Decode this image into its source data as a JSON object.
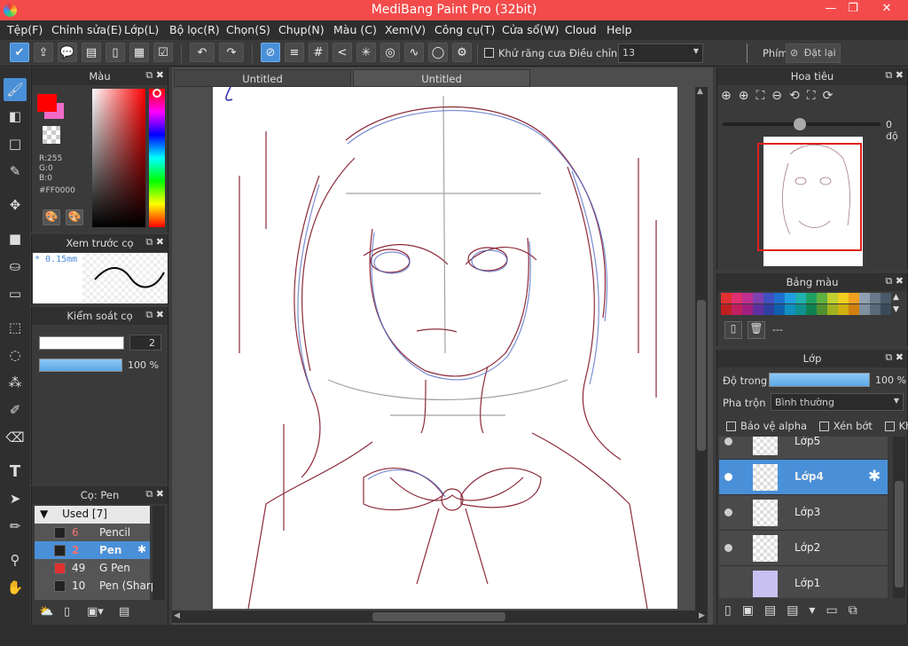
{
  "window": {
    "title": "MediBang Paint Pro (32bit)",
    "min": "—",
    "max": "❐",
    "close": "✕"
  },
  "menu": [
    "Tệp(F)",
    "Chỉnh sửa(E)",
    "Lớp(L)",
    "Bộ lọc(R)",
    "Chọn(S)",
    "Chụp(N)",
    "Màu (C)",
    "Xem(V)",
    "Công cụ(T)",
    "Cửa sổ(W)",
    "Cloud",
    "Help"
  ],
  "toolbar": {
    "antialias_label": "Khử răng cưa",
    "correction_label": "Điều chỉnh",
    "correction_value": "13",
    "key_label": "Phím",
    "reset_label": "Đặt lại"
  },
  "color_panel": {
    "title": "Màu",
    "r": "R:255",
    "g": "G:0",
    "b": "B:0",
    "hex": "#FF0000",
    "fg_color": "#FF0000",
    "bg_color": "#F06CC8"
  },
  "brush_preview": {
    "title": "Xem trước cọ",
    "size": "* 0.15mm"
  },
  "brush_control": {
    "title": "Kiểm soát cọ",
    "size": "2",
    "opacity": "100 %",
    "opacity_value": 1.0
  },
  "brush_panel": {
    "title": "Cọ: Pen",
    "group": "Used [7]",
    "items": [
      {
        "num": "6",
        "name": "Pencil",
        "color": "#222222"
      },
      {
        "num": "2",
        "name": "Pen",
        "color": "#222222"
      },
      {
        "num": "49",
        "name": "G Pen",
        "color": "#e03030"
      },
      {
        "num": "10",
        "name": "Pen (Sharp",
        "color": "#222222"
      }
    ]
  },
  "canvas": {
    "tabs": [
      "Untitled",
      "Untitled"
    ]
  },
  "navigator": {
    "title": "Hoa tiêu",
    "rotation": "0 độ"
  },
  "palette": {
    "title": "Bảng màu",
    "label": "---",
    "colors": [
      "#e23030",
      "#e03070",
      "#c03090",
      "#8040b0",
      "#4050c0",
      "#2070d0",
      "#20a0e0",
      "#20b0b0",
      "#20a060",
      "#60b040",
      "#c0d030",
      "#f0d020",
      "#f0a020",
      "#90a0b0",
      "#6a7a8a",
      "#4a5a6a",
      "#c02020",
      "#c02060",
      "#a02080",
      "#6030a0",
      "#3040a0",
      "#1060b0",
      "#1090c0",
      "#109090",
      "#108050",
      "#509030",
      "#a0b020",
      "#d0b010",
      "#d08010",
      "#8090a0",
      "#5a6a7a",
      "#3a4a5a"
    ]
  },
  "layers": {
    "title": "Lớp",
    "opacity_label": "Độ trong",
    "opacity": "100 %",
    "opacity_value": 1.0,
    "blend_label": "Pha trộn",
    "blend_value": "Bình thường",
    "protect_alpha": "Bảo vệ alpha",
    "clip": "Xén bớt",
    "lock": "Khóa",
    "items": [
      {
        "name": "Lớp5"
      },
      {
        "name": "Lớp4"
      },
      {
        "name": "Lớp3"
      },
      {
        "name": "Lớp2"
      },
      {
        "name": "Lớp1"
      }
    ]
  }
}
